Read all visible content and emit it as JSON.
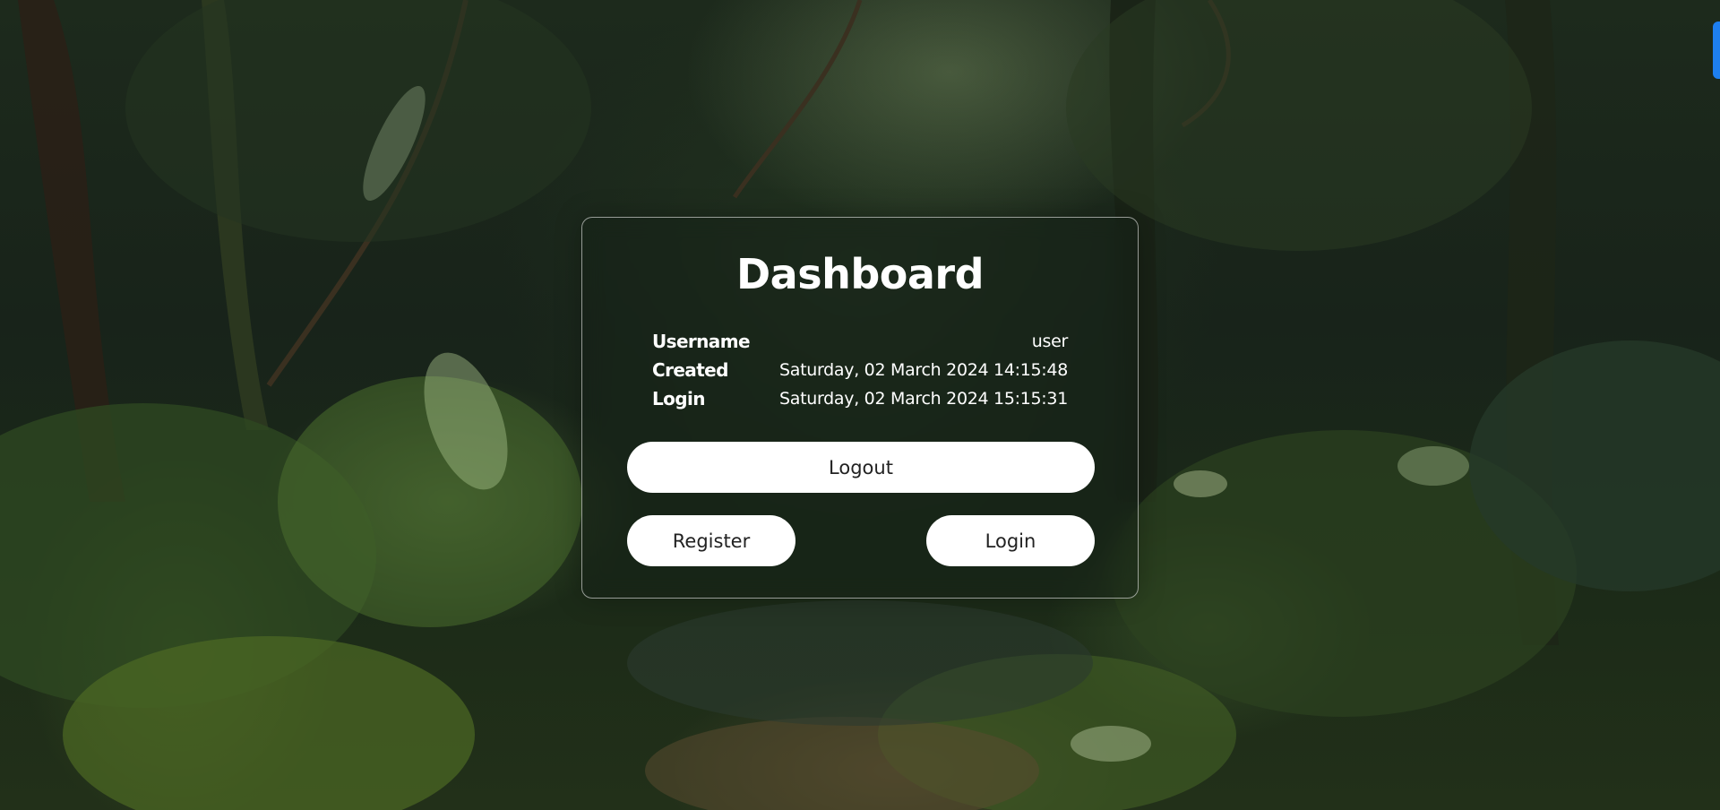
{
  "page": {
    "accent_color": "#1e7ff0"
  },
  "dashboard": {
    "title": "Dashboard",
    "rows": [
      {
        "label": "Username",
        "value": "user"
      },
      {
        "label": "Created",
        "value": "Saturday, 02 March 2024 14:15:48"
      },
      {
        "label": "Login",
        "value": "Saturday, 02 March 2024 15:15:31"
      }
    ],
    "buttons": {
      "logout": "Logout",
      "register": "Register",
      "login": "Login"
    }
  }
}
